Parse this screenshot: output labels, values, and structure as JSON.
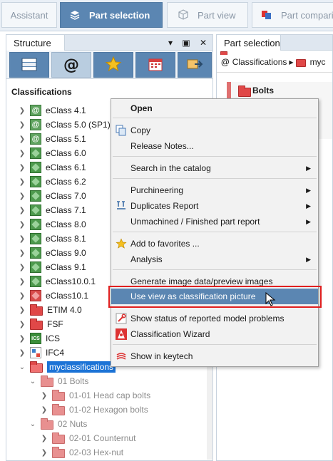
{
  "top_tabs": {
    "assistant": "Assistant",
    "part_selection": "Part selection",
    "part_view": "Part view",
    "part_comparison": "Part compari"
  },
  "left_panel": {
    "tab": "Structure",
    "section_title": "Classifications",
    "tree": [
      {
        "label": "eClass 4.1",
        "icon": "at-icon"
      },
      {
        "label": "eClass 5.0 (SP1)",
        "icon": "at-icon"
      },
      {
        "label": "eClass 5.1",
        "icon": "at-icon"
      },
      {
        "label": "eClass 6.0",
        "icon": "eclass-icon"
      },
      {
        "label": "eClass 6.1",
        "icon": "eclass-icon"
      },
      {
        "label": "eClass 6.2",
        "icon": "eclass-icon"
      },
      {
        "label": "eClass 7.0",
        "icon": "eclass-icon"
      },
      {
        "label": "eClass 7.1",
        "icon": "eclass-icon"
      },
      {
        "label": "eClass 8.0",
        "icon": "eclass-icon"
      },
      {
        "label": "eClass 8.1",
        "icon": "eclass-icon"
      },
      {
        "label": "eClass 9.0",
        "icon": "eclass-icon"
      },
      {
        "label": "eClass 9.1",
        "icon": "eclass-icon"
      },
      {
        "label": "eClass10.0.1",
        "icon": "eclass-icon"
      },
      {
        "label": "eClass10.1",
        "icon": "eclass-red-icon"
      },
      {
        "label": "ETIM 4.0",
        "icon": "folder-icon"
      },
      {
        "label": "FSF",
        "icon": "folder-icon"
      },
      {
        "label": "ICS",
        "icon": "ics-icon"
      },
      {
        "label": "IFC4",
        "icon": "ifc-icon"
      },
      {
        "label": "myclassifications",
        "icon": "folder-open-icon"
      },
      {
        "label": "01 Bolts",
        "icon": "folder-icon"
      },
      {
        "label": "01-01 Head cap bolts",
        "icon": "folder-icon"
      },
      {
        "label": "01-02 Hexagon bolts",
        "icon": "folder-icon"
      },
      {
        "label": "02 Nuts",
        "icon": "folder-icon"
      },
      {
        "label": "02-01 Counternut",
        "icon": "folder-icon"
      },
      {
        "label": "02-03 Hex-nut",
        "icon": "folder-icon"
      }
    ]
  },
  "right_panel": {
    "tab": "Part selection",
    "breadcrumb_root": "Classifications",
    "breadcrumb_next": "myc",
    "card_title": "Bolts"
  },
  "context_menu": {
    "items": [
      {
        "label": "Open"
      },
      {
        "label": "Copy"
      },
      {
        "label": "Release Notes..."
      },
      {
        "label": "Search in the catalog"
      },
      {
        "label": "Purchineering"
      },
      {
        "label": "Duplicates Report"
      },
      {
        "label": "Unmachined / Finished part report"
      },
      {
        "label": "Add to favorites ..."
      },
      {
        "label": "Analysis"
      },
      {
        "label": "Generate image data/preview images"
      },
      {
        "label": "Use view as classification picture"
      },
      {
        "label": "Show status of reported model problems"
      },
      {
        "label": "Classification Wizard"
      },
      {
        "label": "Show in keytech"
      }
    ]
  },
  "colors": {
    "accent": "#5b86b2",
    "highlight_box": "#e01f1f",
    "selection": "#1c73d6"
  }
}
